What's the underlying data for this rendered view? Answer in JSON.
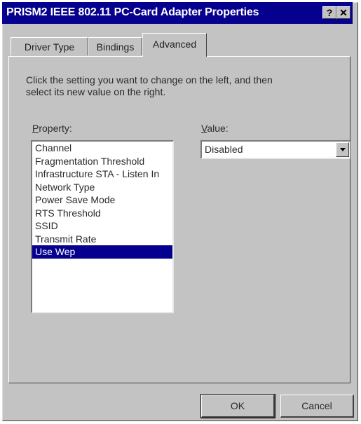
{
  "window": {
    "title": "PRISM2 IEEE 802.11 PC-Card Adapter Properties",
    "help_glyph": "?",
    "close_glyph": "✕"
  },
  "tabs": [
    {
      "label": "Driver Type",
      "active": false
    },
    {
      "label": "Bindings",
      "active": false
    },
    {
      "label": "Advanced",
      "active": true
    }
  ],
  "advanced": {
    "instructions": "Click the setting you want to change on the left, and then\nselect its new value on the right.",
    "property_label": "Property:",
    "value_label": "Value:",
    "properties": [
      "Channel",
      "Fragmentation Threshold",
      "Infrastructure STA - Listen In",
      "Network Type",
      "Power Save Mode",
      "RTS Threshold",
      "SSID",
      "Transmit Rate",
      "Use Wep"
    ],
    "selected_property": "Use Wep",
    "value_selected": "Disabled"
  },
  "buttons": {
    "ok": "OK",
    "cancel": "Cancel"
  },
  "colors": {
    "face": "#c3c3c3",
    "titlebar": "#06008e",
    "selection": "#06008e"
  },
  "icons": {
    "help": "question-mark-icon",
    "close": "close-icon",
    "dropdown": "chevron-down-icon"
  }
}
